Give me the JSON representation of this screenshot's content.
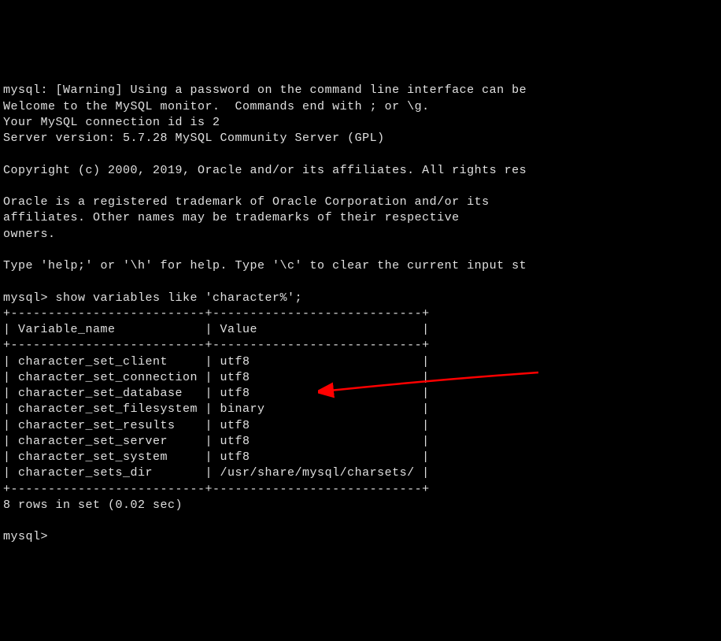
{
  "banner": {
    "warning": "mysql: [Warning] Using a password on the command line interface can be",
    "welcome": "Welcome to the MySQL monitor.  Commands end with ; or \\g.",
    "connection": "Your MySQL connection id is 2",
    "server_version": "Server version: 5.7.28 MySQL Community Server (GPL)",
    "copyright": "Copyright (c) 2000, 2019, Oracle and/or its affiliates. All rights res",
    "trademark1": "Oracle is a registered trademark of Oracle Corporation and/or its",
    "trademark2": "affiliates. Other names may be trademarks of their respective",
    "trademark3": "owners.",
    "help": "Type 'help;' or '\\h' for help. Type '\\c' to clear the current input st"
  },
  "prompt1": "mysql> ",
  "command1": "show variables like 'character%';",
  "table": {
    "border_top": "+--------------------------+----------------------------+",
    "header": "| Variable_name            | Value                      |",
    "border_mid": "+--------------------------+----------------------------+",
    "rows": [
      "| character_set_client     | utf8                       |",
      "| character_set_connection | utf8                       |",
      "| character_set_database   | utf8                       |",
      "| character_set_filesystem | binary                     |",
      "| character_set_results    | utf8                       |",
      "| character_set_server     | utf8                       |",
      "| character_set_system     | utf8                       |",
      "| character_sets_dir       | /usr/share/mysql/charsets/ |"
    ],
    "border_bot": "+--------------------------+----------------------------+"
  },
  "result_summary": "8 rows in set (0.02 sec)",
  "prompt2": "mysql>",
  "annotation": {
    "arrow_color": "#ff0000"
  }
}
